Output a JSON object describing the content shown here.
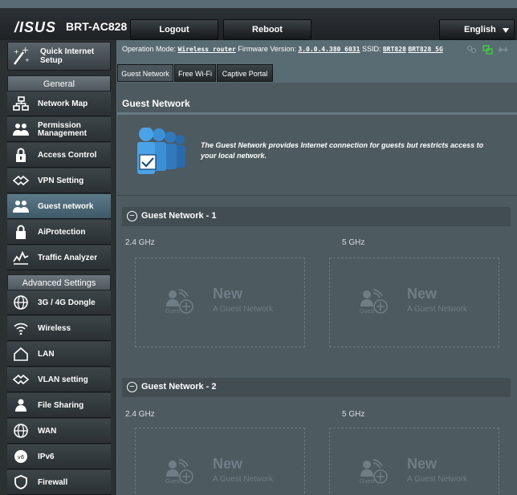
{
  "header": {
    "brand": "/ISUS",
    "model": "BRT-AC828",
    "logout_label": "Logout",
    "reboot_label": "Reboot",
    "language": "English"
  },
  "sidebar": {
    "quick_setup": "Quick Internet Setup",
    "general_heading": "General",
    "general_items": [
      {
        "label": "Network Map",
        "icon": "network-map-icon"
      },
      {
        "label": "Permission Management",
        "icon": "permission-icon"
      },
      {
        "label": "Access Control",
        "icon": "lock-icon"
      },
      {
        "label": "VPN Setting",
        "icon": "vpn-icon"
      },
      {
        "label": "Guest network",
        "icon": "guest-icon"
      },
      {
        "label": "AiProtection",
        "icon": "shield-lock-icon"
      },
      {
        "label": "Traffic Analyzer",
        "icon": "traffic-icon"
      }
    ],
    "advanced_heading": "Advanced Settings",
    "advanced_items": [
      {
        "label": "3G / 4G Dongle",
        "icon": "globe-icon"
      },
      {
        "label": "Wireless",
        "icon": "wifi-icon"
      },
      {
        "label": "LAN",
        "icon": "home-icon"
      },
      {
        "label": "VLAN setting",
        "icon": "vlan-icon"
      },
      {
        "label": "File Sharing",
        "icon": "file-sharing-icon"
      },
      {
        "label": "WAN",
        "icon": "wan-globe-icon"
      },
      {
        "label": "IPv6",
        "icon": "ipv6-icon"
      },
      {
        "label": "Firewall",
        "icon": "firewall-icon"
      }
    ]
  },
  "status": {
    "op_mode_label": "Operation Mode:",
    "op_mode_value": "Wireless router",
    "fw_label": "Firmware Version:",
    "fw_value": "3.0.0.4.380_6031",
    "ssid_label": "SSID:",
    "ssid_1": "BRT828",
    "ssid_2": "BRT828_5G"
  },
  "tabs": [
    "Guest Network",
    "Free Wi-Fi",
    "Captive Portal"
  ],
  "main": {
    "title": "Guest Network",
    "intro": "The Guest Network provides Internet connection for guests but restricts access to your local network.",
    "groups": [
      {
        "title": "Guest Network - 1",
        "band_a": "2.4 GHz",
        "band_b": "5 GHz"
      },
      {
        "title": "Guest Network - 2",
        "band_a": "2.4 GHz",
        "band_b": "5 GHz"
      }
    ],
    "new_title": "New",
    "new_subtitle": "A Guest Network",
    "guest_word": "Guest"
  },
  "colors": {
    "accent": "#3b8fd4",
    "panel": "#4d5a60",
    "sidebar": "#2b3033"
  }
}
